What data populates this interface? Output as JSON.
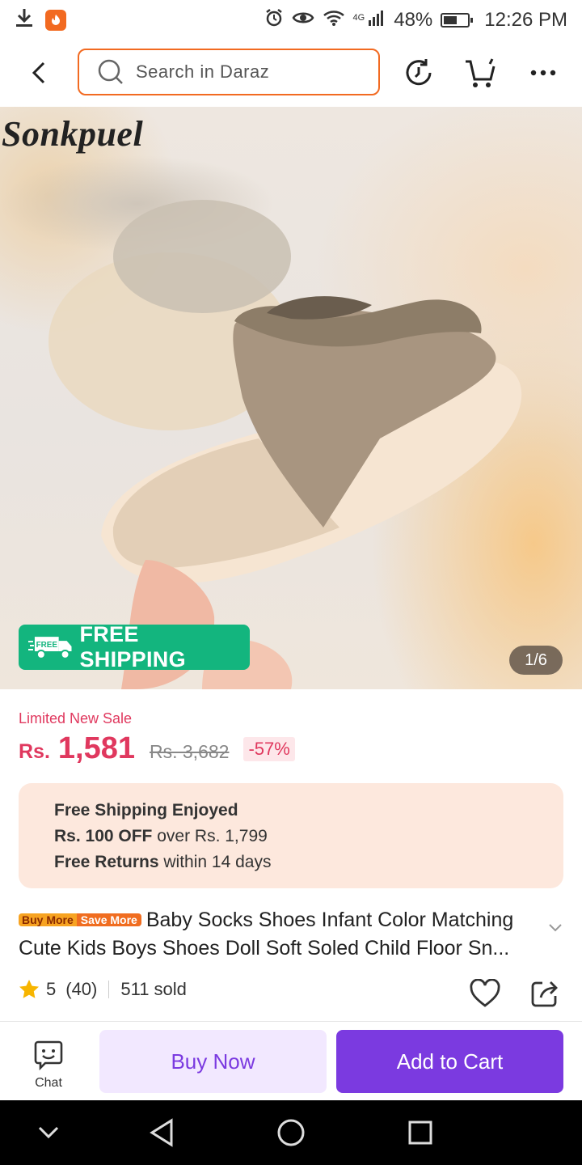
{
  "status_bar": {
    "network_label": "4G",
    "battery": "48%",
    "battery_level": 0.48,
    "time": "12:26 PM"
  },
  "header": {
    "search_placeholder": "Search in Daraz",
    "icons": [
      "back-icon",
      "search-icon",
      "history-icon",
      "cart-icon",
      "more-icon"
    ]
  },
  "hero": {
    "brand": "Sonkpuel",
    "free_shipping": "FREE SHIPPING",
    "free_badge_word": "FREE",
    "counter": "1/6"
  },
  "pricing": {
    "sale_label": "Limited New Sale",
    "currency": "Rs.",
    "price": "1,581",
    "original_price": "Rs. 3,682",
    "discount": "-57%"
  },
  "benefits": {
    "line1": "Free Shipping Enjoyed",
    "line2_bold": "Rs. 100 OFF",
    "line2_rest": " over Rs. 1,799",
    "line3_bold": "Free Returns",
    "line3_rest": " within 14 days"
  },
  "product": {
    "promo_tag_a": "Buy More",
    "promo_tag_b": "Save More",
    "title": "Baby Socks Shoes Infant Color Matching Cute Kids Boys Shoes Doll Soft Soled Child Floor Sn...",
    "rating": "5",
    "reviews": "(40)",
    "sold": "511 sold"
  },
  "actions": {
    "chat": "Chat",
    "buy_now": "Buy Now",
    "add_to_cart": "Add to Cart"
  },
  "colors": {
    "accent_orange": "#f26a21",
    "price_red": "#e0385e",
    "brand_purple": "#7b3ae0",
    "free_ship_green": "#13b57e"
  }
}
